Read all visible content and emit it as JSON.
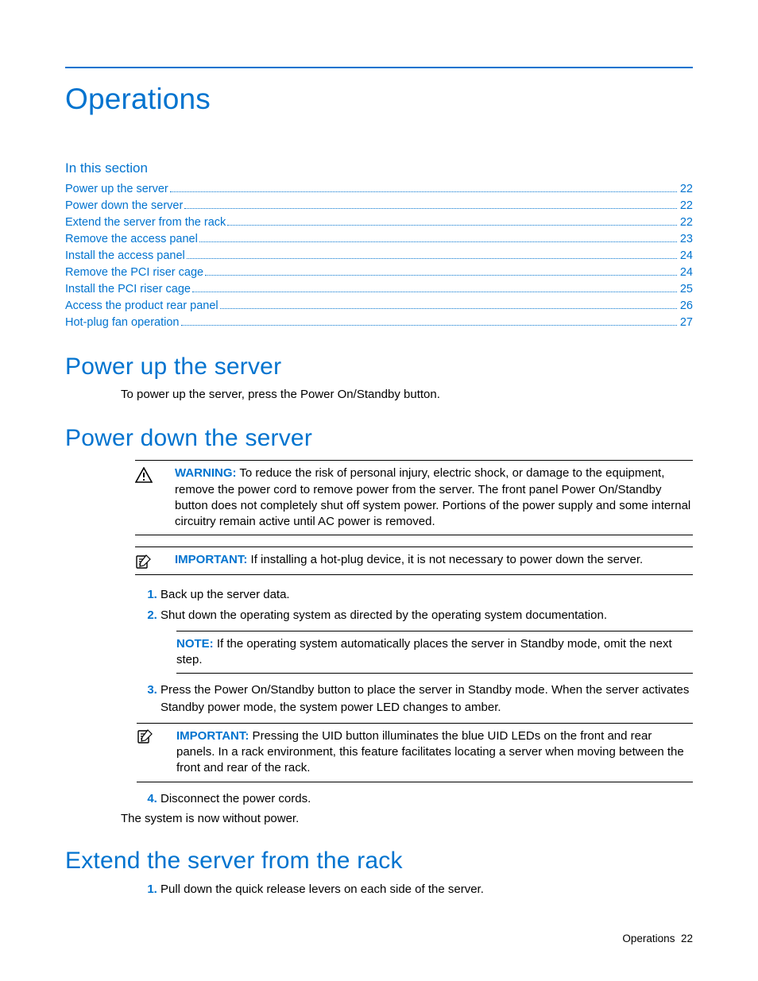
{
  "chapter_title": "Operations",
  "toc_heading": "In this section",
  "toc": [
    {
      "label": "Power up the server",
      "page": "22"
    },
    {
      "label": "Power down the server",
      "page": "22"
    },
    {
      "label": "Extend the server from the rack",
      "page": "22"
    },
    {
      "label": "Remove the access panel",
      "page": "23"
    },
    {
      "label": "Install the access panel",
      "page": "24"
    },
    {
      "label": "Remove the PCI riser cage",
      "page": "24"
    },
    {
      "label": "Install the PCI riser cage",
      "page": "25"
    },
    {
      "label": "Access the product rear panel",
      "page": "26"
    },
    {
      "label": "Hot-plug fan operation",
      "page": "27"
    }
  ],
  "sections": {
    "power_up": {
      "heading": "Power up the server",
      "body": "To power up the server, press the Power On/Standby button."
    },
    "power_down": {
      "heading": "Power down the server",
      "warning_label": "WARNING:",
      "warning_text": "  To reduce the risk of personal injury, electric shock, or damage to the equipment, remove the power cord to remove power from the server. The front panel Power On/Standby button does not completely shut off system power. Portions of the power supply and some internal circuitry remain active until AC power is removed.",
      "important_label": "IMPORTANT:",
      "important_text": "  If installing a hot-plug device, it is not necessary to power down the server.",
      "steps": {
        "s1": "Back up the server data.",
        "s2": "Shut down the operating system as directed by the operating system documentation.",
        "note_label": "NOTE:",
        "note_text": "  If the operating system automatically places the server in Standby mode, omit the next step.",
        "s3": "Press the Power On/Standby button to place the server in Standby mode. When the server activates Standby power mode, the system power LED changes to amber.",
        "important2_label": "IMPORTANT:",
        "important2_text": "  Pressing the UID button illuminates the blue UID LEDs on the front and rear panels. In a rack environment, this feature facilitates locating a server when moving between the front and rear of the rack.",
        "s4": "Disconnect the power cords."
      },
      "conclusion": "The system is now without power."
    },
    "extend": {
      "heading": "Extend the server from the rack",
      "steps": {
        "s1": "Pull down the quick release levers on each side of the server."
      }
    }
  },
  "footer": {
    "label": "Operations",
    "page": "22"
  },
  "icons": {
    "warning": "warning-triangle-icon",
    "note": "note-pencil-icon"
  }
}
